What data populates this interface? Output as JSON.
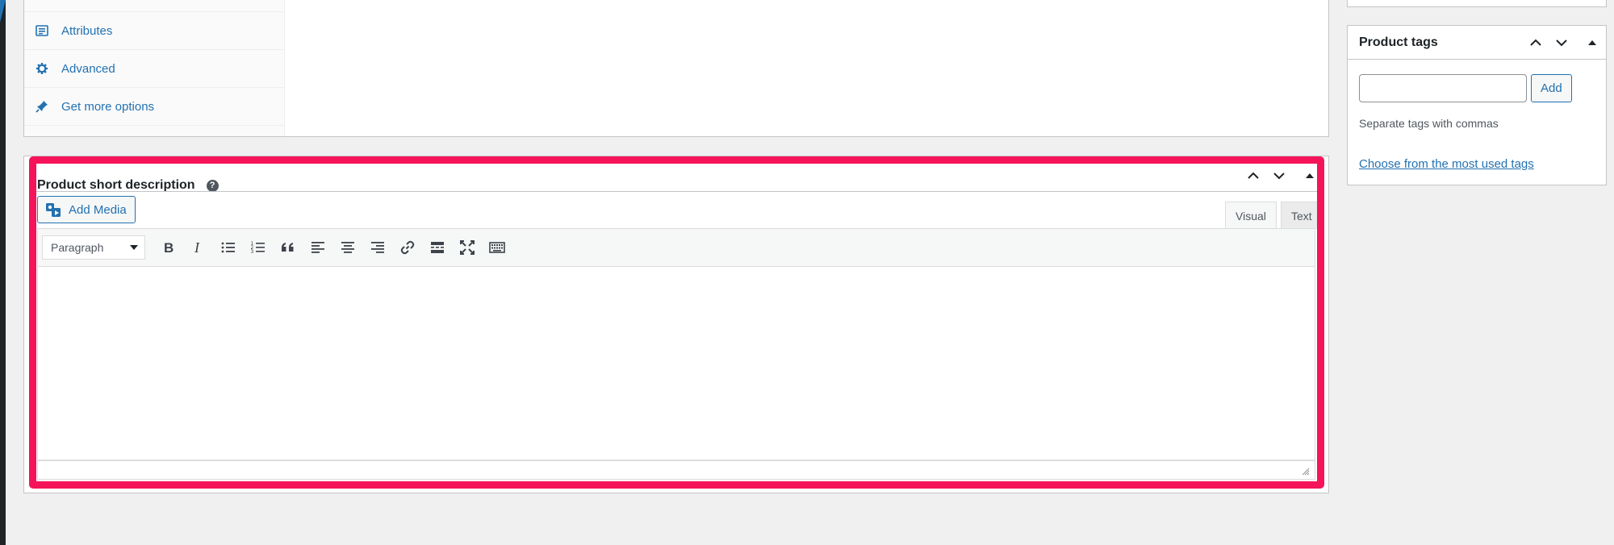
{
  "product_data": {
    "tabs": [
      {
        "label": "",
        "icon": "tab-icon"
      },
      {
        "label": "Attributes",
        "icon": "attributes-icon"
      },
      {
        "label": "Advanced",
        "icon": "gear-icon"
      },
      {
        "label": "Get more options",
        "icon": "plugin-icon"
      }
    ]
  },
  "short_description": {
    "title": "Product short description",
    "help": "?",
    "add_media_label": "Add Media",
    "mode_tabs": {
      "visual": "Visual",
      "text": "Text"
    },
    "format_select": {
      "selected": "Paragraph"
    },
    "toolbar_buttons": [
      "bold",
      "italic",
      "bulleted-list",
      "numbered-list",
      "blockquote",
      "align-left",
      "align-center",
      "align-right",
      "insert-link",
      "read-more",
      "fullscreen",
      "toolbar-toggle"
    ],
    "content": "",
    "highlight_color": "#f5145a"
  },
  "product_tags": {
    "title": "Product tags",
    "input_value": "",
    "add_label": "Add",
    "hint": "Separate tags with commas",
    "most_used_link": "Choose from the most used tags"
  },
  "colors": {
    "link": "#2271b1",
    "background": "#f0f0f1",
    "border": "#c3c4c7"
  }
}
